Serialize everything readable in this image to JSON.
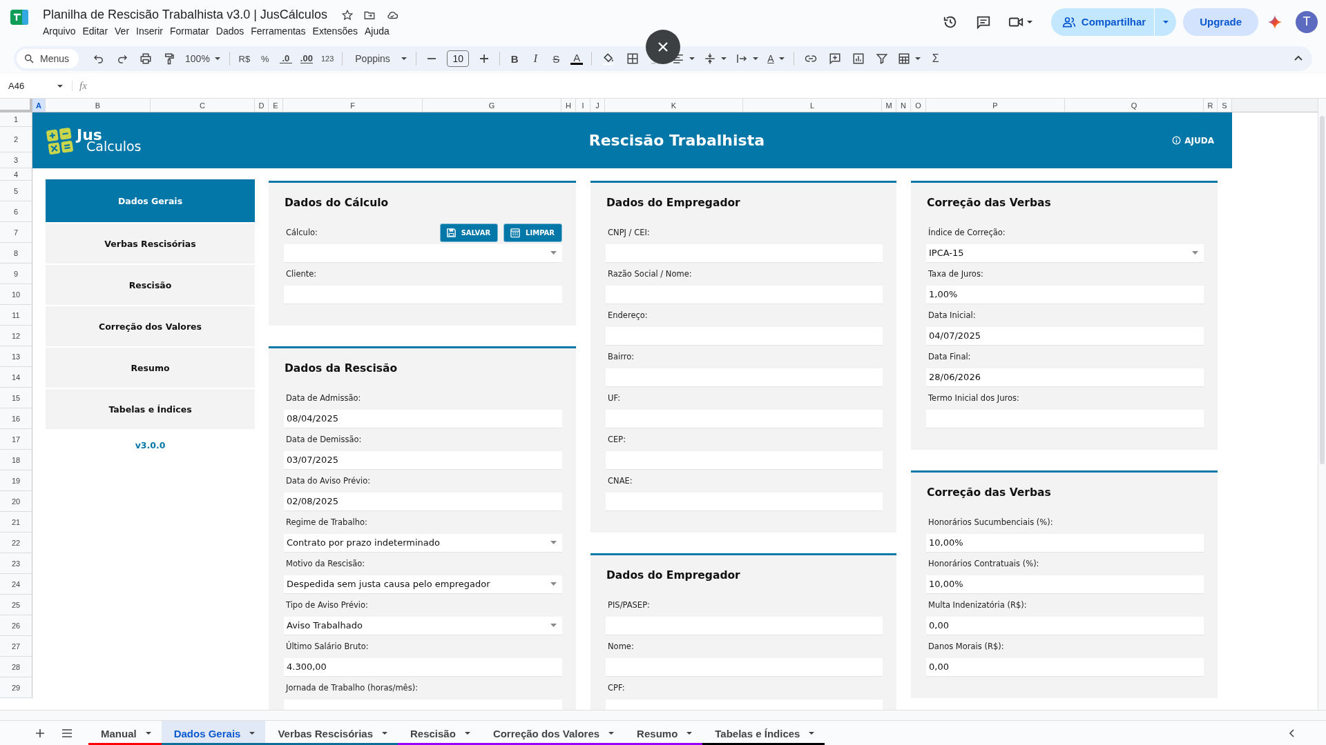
{
  "document": {
    "title": "Planilha de Rescisão Trabalhista v3.0 | JusCálculos",
    "menus": [
      "Arquivo",
      "Editar",
      "Ver",
      "Inserir",
      "Formatar",
      "Dados",
      "Ferramentas",
      "Extensões",
      "Ajuda"
    ]
  },
  "header_actions": {
    "share": "Compartilhar",
    "upgrade": "Upgrade",
    "avatar": "T"
  },
  "toolbar": {
    "search": "Menus",
    "zoom": "100%",
    "currency": "R$",
    "percent": "%",
    "decrease_decimals": ".0",
    "increase_decimals": ".00",
    "number_format": "123",
    "font": "Poppins",
    "font_size": "10",
    "bold": "B",
    "italic": "I",
    "strikethrough": "S",
    "text_color": "A",
    "text_rotation": "A",
    "function": "Σ"
  },
  "formula_bar": {
    "name_box": "A46",
    "fx": "fx"
  },
  "columns": [
    {
      "label": "A",
      "selected": true
    },
    {
      "label": "B",
      "selected": false
    },
    {
      "label": "C",
      "selected": false
    },
    {
      "label": "D",
      "selected": false
    },
    {
      "label": "E",
      "selected": false
    },
    {
      "label": "F",
      "selected": false
    },
    {
      "label": "G",
      "selected": false
    },
    {
      "label": "H",
      "selected": false
    },
    {
      "label": "I",
      "selected": false
    },
    {
      "label": "J",
      "selected": false
    },
    {
      "label": "K",
      "selected": false
    },
    {
      "label": "L",
      "selected": false
    },
    {
      "label": "M",
      "selected": false
    },
    {
      "label": "N",
      "selected": false
    },
    {
      "label": "O",
      "selected": false
    },
    {
      "label": "P",
      "selected": false
    },
    {
      "label": "Q",
      "selected": false
    },
    {
      "label": "R",
      "selected": false
    },
    {
      "label": "S",
      "selected": false
    }
  ],
  "rows": [
    "1",
    "2",
    "3",
    "4",
    "5",
    "6",
    "7",
    "8",
    "9",
    "10",
    "11",
    "12",
    "13",
    "14",
    "15",
    "16",
    "17",
    "18",
    "19",
    "20",
    "21",
    "22",
    "23",
    "24",
    "25",
    "26",
    "27",
    "28",
    "29"
  ],
  "banner": {
    "logo_top": "Jus",
    "logo_bottom": "Calculos",
    "title": "Rescisão Trabalhista",
    "help": "AJUDA"
  },
  "nav": {
    "items": [
      {
        "label": "Dados Gerais",
        "selected": true
      },
      {
        "label": "Verbas Rescisórias",
        "selected": false
      },
      {
        "label": "Rescisão",
        "selected": false
      },
      {
        "label": "Correção dos Valores",
        "selected": false
      },
      {
        "label": "Resumo",
        "selected": false
      },
      {
        "label": "Tabelas e Índices",
        "selected": false
      }
    ],
    "version": "v3.0.0"
  },
  "panel_columns": [
    [
      {
        "title": "Dados do Cálculo",
        "buttons": [
          "SALVAR",
          "LIMPAR"
        ],
        "fields": [
          {
            "label": "Cálculo:",
            "kind": "dropdown"
          },
          {
            "label": "Cliente:",
            "kind": "text"
          }
        ]
      },
      {
        "title": "Dados da Rescisão",
        "fields": [
          {
            "label": "Data de Admissão:",
            "kind": "text",
            "value": "08/04/2025"
          },
          {
            "label": "Data de Demissão:",
            "kind": "text",
            "value": "03/07/2025"
          },
          {
            "label": "Data do Aviso Prévio:",
            "kind": "text",
            "value": "02/08/2025"
          },
          {
            "label": "Regime de Trabalho:",
            "kind": "dropdown",
            "value": "Contrato por prazo indeterminado"
          },
          {
            "label": "Motivo da Rescisão:",
            "kind": "dropdown",
            "value": "Despedida sem justa causa pelo empregador"
          },
          {
            "label": "Tipo de Aviso Prévio:",
            "kind": "dropdown",
            "value": "Aviso Trabalhado"
          },
          {
            "label": "Último Salário Bruto:",
            "kind": "text",
            "value": "4.300,00"
          },
          {
            "label": "Jornada de Trabalho (horas/mês):",
            "kind": "text"
          }
        ]
      }
    ],
    [
      {
        "title": "Dados do Empregador",
        "fields": [
          {
            "label": "CNPJ / CEI:",
            "kind": "text"
          },
          {
            "label": "Razão Social / Nome:",
            "kind": "text"
          },
          {
            "label": "Endereço:",
            "kind": "text"
          },
          {
            "label": "Bairro:",
            "kind": "text"
          },
          {
            "label": "UF:",
            "kind": "text"
          },
          {
            "label": "CEP:",
            "kind": "text"
          },
          {
            "label": "CNAE:",
            "kind": "text"
          }
        ]
      },
      {
        "title": "Dados do Empregador",
        "fields": [
          {
            "label": "PIS/PASEP:",
            "kind": "text"
          },
          {
            "label": "Nome:",
            "kind": "text"
          },
          {
            "label": "CPF:",
            "kind": "text"
          }
        ]
      }
    ],
    [
      {
        "title": "Correção das Verbas",
        "fields": [
          {
            "label": "Índice de Correção:",
            "kind": "dropdown",
            "value": "IPCA-15"
          },
          {
            "label": "Taxa de Juros:",
            "kind": "text",
            "value": "1,00%"
          },
          {
            "label": "Data Inicial:",
            "kind": "text",
            "value": "04/07/2025"
          },
          {
            "label": "Data Final:",
            "kind": "text",
            "value": "28/06/2026"
          },
          {
            "label": "Termo Inicial dos Juros:",
            "kind": "text"
          }
        ]
      },
      {
        "title": "Correção das Verbas",
        "fields": [
          {
            "label": "Honorários Sucumbenciais (%):",
            "kind": "text",
            "value": "10,00%"
          },
          {
            "label": "Honorários Contratuais (%):",
            "kind": "text",
            "value": "10,00%"
          },
          {
            "label": "Multa Indenizatória (R$):",
            "kind": "text",
            "value": "0,00"
          },
          {
            "label": "Danos Morais (R$):",
            "kind": "text",
            "value": "0,00"
          }
        ]
      }
    ]
  ],
  "sheet_tabs": [
    {
      "label": "Manual",
      "selected": false,
      "color": "#ff0000"
    },
    {
      "label": "Dados Gerais",
      "selected": true,
      "color": "#0b6e99"
    },
    {
      "label": "Verbas Rescisórias",
      "selected": false,
      "color": "#0b6e99"
    },
    {
      "label": "Rescisão",
      "selected": false,
      "color": "#9900ff"
    },
    {
      "label": "Correção dos Valores",
      "selected": false,
      "color": "#9900ff"
    },
    {
      "label": "Resumo",
      "selected": false,
      "color": "#9900ff"
    },
    {
      "label": "Tabelas e Índices",
      "selected": false,
      "color": "#000000"
    }
  ]
}
